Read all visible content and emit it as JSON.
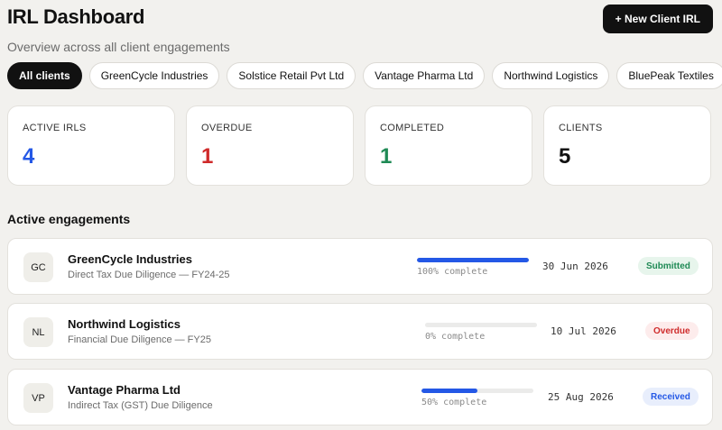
{
  "header": {
    "title": "IRL Dashboard",
    "subtitle": "Overview across all client engagements",
    "new_button": "+ New Client IRL"
  },
  "filters": [
    {
      "label": "All clients",
      "active": true
    },
    {
      "label": "GreenCycle Industries",
      "active": false
    },
    {
      "label": "Solstice Retail Pvt Ltd",
      "active": false
    },
    {
      "label": "Vantage Pharma Ltd",
      "active": false
    },
    {
      "label": "Northwind Logistics",
      "active": false
    },
    {
      "label": "BluePeak Textiles",
      "active": false
    }
  ],
  "stats": [
    {
      "label": "ACTIVE IRLS",
      "value": "4",
      "color": "#2458e6"
    },
    {
      "label": "OVERDUE",
      "value": "1",
      "color": "#cf2a2a"
    },
    {
      "label": "COMPLETED",
      "value": "1",
      "color": "#1f8a55"
    },
    {
      "label": "CLIENTS",
      "value": "5",
      "color": "#111111"
    }
  ],
  "section_title": "Active engagements",
  "engagements": [
    {
      "initials": "GC",
      "name": "GreenCycle Industries",
      "description": "Direct Tax Due Diligence — FY24-25",
      "progress": 100,
      "progress_text": "100% complete",
      "date": "30 Jun 2026",
      "status": "Submitted"
    },
    {
      "initials": "NL",
      "name": "Northwind Logistics",
      "description": "Financial Due Diligence — FY25",
      "progress": 0,
      "progress_text": "0% complete",
      "date": "10 Jul 2026",
      "status": "Overdue"
    },
    {
      "initials": "VP",
      "name": "Vantage Pharma Ltd",
      "description": "Indirect Tax (GST) Due Diligence",
      "progress": 50,
      "progress_text": "50% complete",
      "date": "25 Aug 2026",
      "status": "Received"
    }
  ]
}
